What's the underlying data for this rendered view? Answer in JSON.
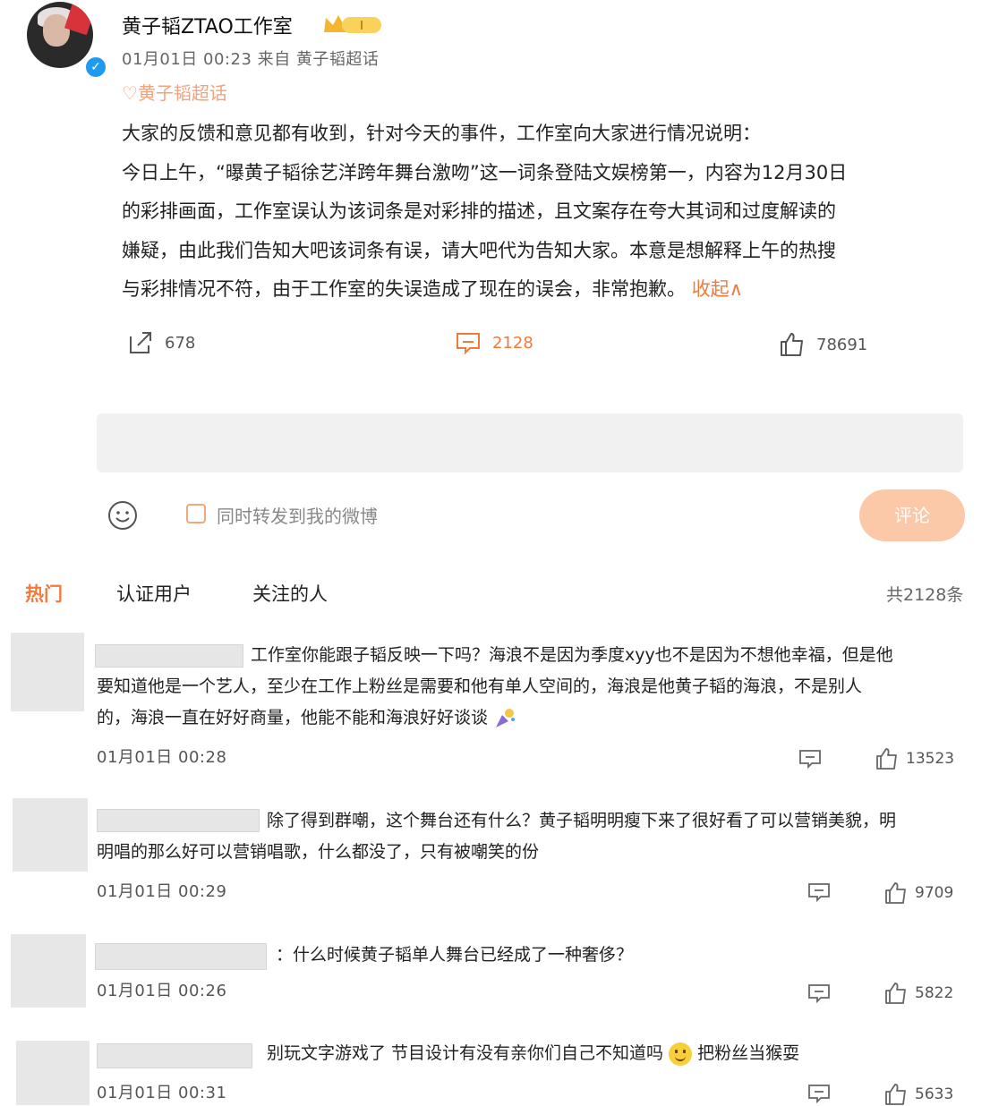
{
  "post": {
    "username": "黄子韬ZTAO工作室",
    "meta": "01月01日 00:23  来自 黄子韬超话",
    "tag": "黄子韬超话",
    "lines": [
      "大家的反馈和意见都有收到，针对今天的事件，工作室向大家进行情况说明：",
      "今日上午，“曝黄子韬徐艺洋跨年舞台激吻”这一词条登陆文娱榜第一，内容为12月30日",
      "的彩排画面，工作室误认为该词条是对彩排的描述，且文案存在夸大其词和过度解读的",
      "嫌疑，由此我们告知大吧该词条有误，请大吧代为告知大家。本意是想解释上午的热搜",
      "与彩排情况不符，由于工作室的失误造成了现在的误会，非常抱歉。"
    ],
    "collapse_label": "收起∧",
    "reposts": "678",
    "comments": "2128",
    "likes": "78691"
  },
  "composer": {
    "repost_label": "同时转发到我的微博",
    "submit_label": "评论"
  },
  "tabs": {
    "hot": "热门",
    "verified": "认证用户",
    "following": "关注的人",
    "total": "共2128条"
  },
  "comments": [
    {
      "lines": [
        "工作室你能跟子韬反映一下吗？海浪不是因为季度xyy也不是因为不想他幸福，但是他",
        "要知道他是一个艺人，至少在工作上粉丝是需要和他有单人空间的，海浪是他黄子韬的海浪，不是别人",
        "的，海浪一直在好好商量，他能不能和海浪好好谈谈"
      ],
      "time": "01月01日 00:28",
      "likes": "13523"
    },
    {
      "lines": [
        "除了得到群嘲，这个舞台还有什么？黄子韬明明瘦下来了很好看了可以营销美貌，明",
        "明唱的那么好可以营销唱歌，什么都没了，只有被嘲笑的份"
      ],
      "time": "01月01日 00:29",
      "likes": "9709"
    },
    {
      "lines": [
        "：什么时候黄子韬单人舞台已经成了一种奢侈？"
      ],
      "time": "01月01日 00:26",
      "likes": "5822"
    },
    {
      "lines": [
        "别玩文字游戏了 节目设计有没有亲你们自己不知道吗",
        "把粉丝当猴耍"
      ],
      "time": "01月01日 00:31",
      "likes": "5633"
    }
  ],
  "colors": {
    "accent": "#f07a3c",
    "submit_bg": "#fbc8a8",
    "verified_blue": "#1e9bf0"
  }
}
